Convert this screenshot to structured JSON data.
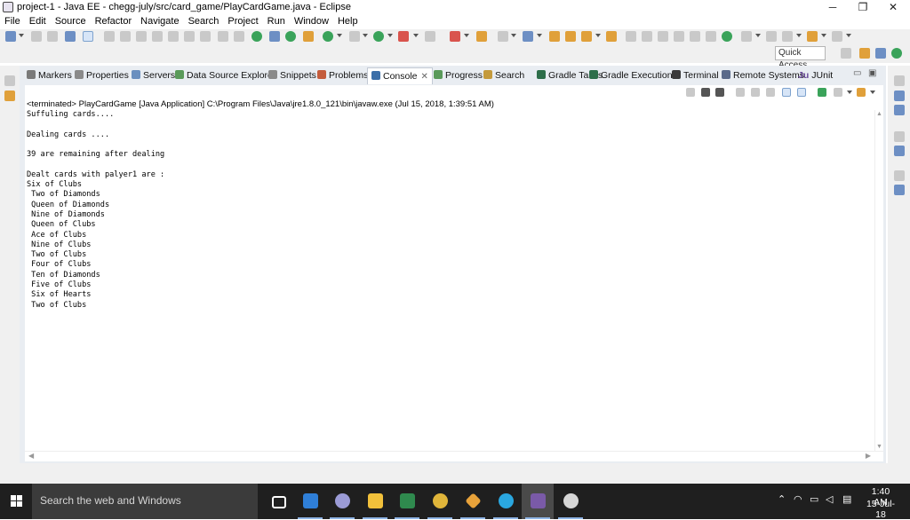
{
  "window": {
    "title": "project-1 - Java EE - chegg-july/src/card_game/PlayCardGame.java - Eclipse",
    "minimize_glyph": "─",
    "maximize_glyph": "❐",
    "close_glyph": "✕"
  },
  "menu": [
    "File",
    "Edit",
    "Source",
    "Refactor",
    "Navigate",
    "Search",
    "Project",
    "Run",
    "Window",
    "Help"
  ],
  "quick_access": {
    "placeholder": "Quick Access"
  },
  "tabs": [
    {
      "label": "Markers",
      "icon": "markers-icon",
      "color": "#7a7a7a"
    },
    {
      "label": "Properties",
      "icon": "properties-icon",
      "color": "#8a8a8a"
    },
    {
      "label": "Servers",
      "icon": "servers-icon",
      "color": "#6a8fbf"
    },
    {
      "label": "Data Source Explorer",
      "icon": "data-source-icon",
      "color": "#5a9a5a"
    },
    {
      "label": "Snippets",
      "icon": "snippets-icon",
      "color": "#8a8a8a"
    },
    {
      "label": "Problems",
      "icon": "problems-icon",
      "color": "#c45c3c"
    },
    {
      "label": "Console",
      "icon": "console-icon",
      "color": "#3b6ea8",
      "active": true,
      "close": "✕"
    },
    {
      "label": "Progress",
      "icon": "progress-icon",
      "color": "#5a9a5a"
    },
    {
      "label": "Search",
      "icon": "search-icon",
      "color": "#c49a3c"
    },
    {
      "label": "Gradle Tasks",
      "icon": "gradle-icon",
      "color": "#2d6e4a"
    },
    {
      "label": "Gradle Executions",
      "icon": "gradle-icon",
      "color": "#2d6e4a"
    },
    {
      "label": "Terminal",
      "icon": "terminal-icon",
      "color": "#3a3a3a"
    },
    {
      "label": "Remote Systems",
      "icon": "remote-systems-icon",
      "color": "#5a6a8a"
    },
    {
      "label": "JUnit",
      "icon": "junit-icon",
      "color": "#6a4a9a",
      "prefix": "Ju"
    }
  ],
  "console": {
    "header": "<terminated> PlayCardGame [Java Application] C:\\Program Files\\Java\\jre1.8.0_121\\bin\\javaw.exe (Jul 15, 2018, 1:39:51 AM)",
    "lines": [
      "Suffuling cards....",
      "",
      "Dealing cards ....",
      "",
      "39 are remaining after dealing",
      "",
      "Dealt cards with palyer1 are :",
      "Six of Clubs",
      " Two of Diamonds",
      " Queen of Diamonds",
      " Nine of Diamonds",
      " Queen of Clubs",
      " Ace of Clubs",
      " Nine of Clubs",
      " Two of Clubs",
      " Four of Clubs",
      " Ten of Diamonds",
      " Five of Clubs",
      " Six of Hearts",
      " Two of Clubs"
    ]
  },
  "taskbar": {
    "search_placeholder": "Search the web and Windows",
    "clock_time": "1:40 AM",
    "clock_date": "15-Jul-18",
    "apps": [
      {
        "name": "task-view",
        "color": "#ffffff"
      },
      {
        "name": "edge",
        "color": "#2f7fd8"
      },
      {
        "name": "app-circle",
        "color": "#9b9bd6"
      },
      {
        "name": "file-explorer",
        "color": "#f2c13b"
      },
      {
        "name": "excel",
        "color": "#2f8a4e"
      },
      {
        "name": "chrome",
        "color": "#e0b53a"
      },
      {
        "name": "git",
        "color": "#e8a23a"
      },
      {
        "name": "skype",
        "color": "#2aa7e0"
      },
      {
        "name": "eclipse",
        "color": "#7a5aa8"
      },
      {
        "name": "app-bird",
        "color": "#d6d6d6"
      }
    ]
  }
}
